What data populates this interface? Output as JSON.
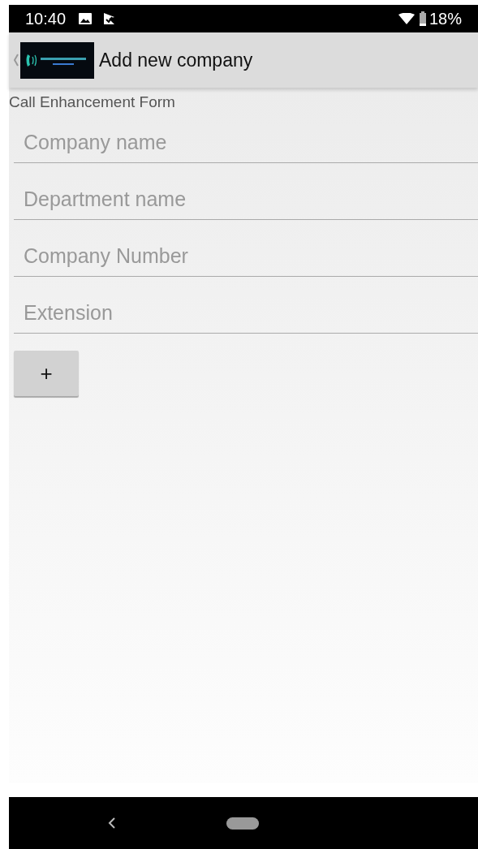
{
  "status_bar": {
    "time": "10:40",
    "battery": "18%"
  },
  "toolbar": {
    "title": "Add new company"
  },
  "form": {
    "heading": "Call Enhancement Form",
    "fields": [
      {
        "placeholder": "Company name"
      },
      {
        "placeholder": "Department name"
      },
      {
        "placeholder": "Company Number"
      },
      {
        "placeholder": "Extension"
      }
    ],
    "add_button": {
      "label": "+"
    }
  }
}
